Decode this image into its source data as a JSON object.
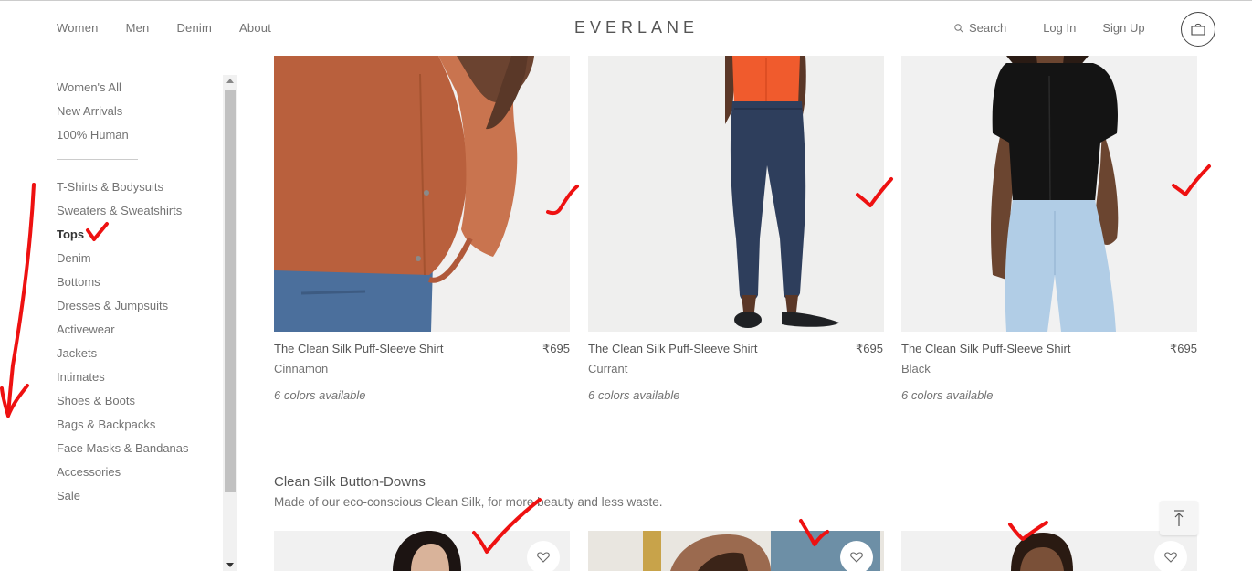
{
  "header": {
    "nav": [
      "Women",
      "Men",
      "Denim",
      "About"
    ],
    "logo": "EVERLANE",
    "search_label": "Search",
    "login_label": "Log In",
    "signup_label": "Sign Up",
    "cart_icon": "bag-icon"
  },
  "sidebar": {
    "top_items": [
      "Women's All",
      "New Arrivals",
      "100% Human"
    ],
    "categories": [
      "T-Shirts & Bodysuits",
      "Sweaters & Sweatshirts",
      "Tops",
      "Denim",
      "Bottoms",
      "Dresses & Jumpsuits",
      "Activewear",
      "Jackets",
      "Intimates",
      "Shoes & Boots",
      "Bags & Backpacks",
      "Face Masks & Bandanas",
      "Accessories",
      "Sale"
    ],
    "active": "Tops"
  },
  "products": [
    {
      "name": "The Clean Silk Puff-Sleeve Shirt",
      "price": "₹695",
      "color": "Cinnamon",
      "availability": "6 colors available",
      "swatch": "#c0623f"
    },
    {
      "name": "The Clean Silk Puff-Sleeve Shirt",
      "price": "₹695",
      "color": "Currant",
      "availability": "6 colors available",
      "swatch": "#f05a2e"
    },
    {
      "name": "The Clean Silk Puff-Sleeve Shirt",
      "price": "₹695",
      "color": "Black",
      "availability": "6 colors available",
      "swatch": "#141414"
    }
  ],
  "section": {
    "title": "Clean Silk Button-Downs",
    "subtitle": "Made of our eco-conscious Clean Silk, for more beauty and less waste."
  },
  "colors": {
    "annotation": "#ee1111",
    "text": "#555555",
    "image_bg": "#f2f2f2"
  }
}
